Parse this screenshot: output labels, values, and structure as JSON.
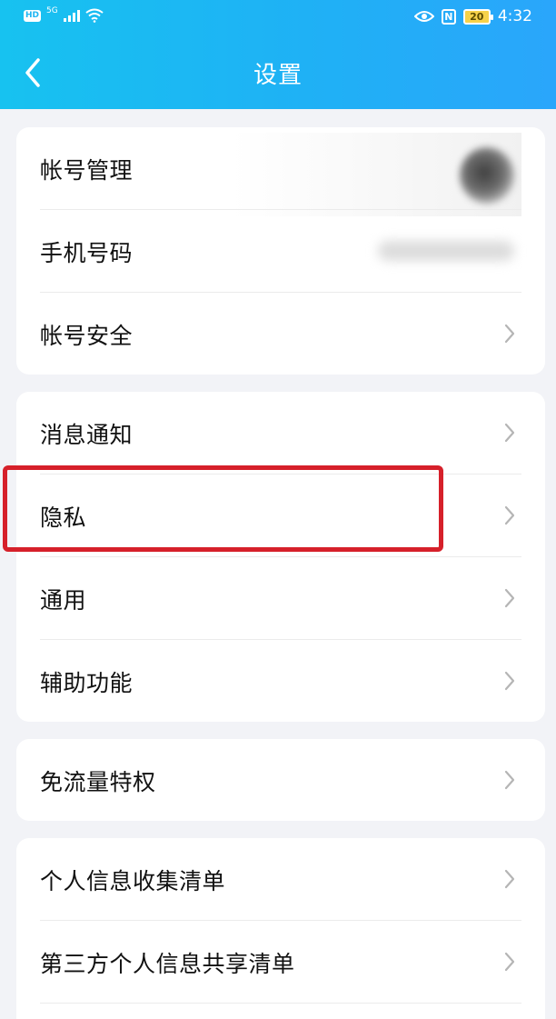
{
  "status_bar": {
    "hd": "HD",
    "network": "5G",
    "time": "4:32",
    "nfc": "N",
    "battery": "20"
  },
  "header": {
    "title": "设置",
    "back_icon": "chevron-left-icon"
  },
  "groups": [
    {
      "items": [
        {
          "label": "帐号管理",
          "trailing": "blurred-avatar"
        },
        {
          "label": "手机号码",
          "trailing": "blurred-phone-number"
        },
        {
          "label": "帐号安全",
          "trailing": "chevron-right-icon"
        }
      ]
    },
    {
      "items": [
        {
          "label": "消息通知",
          "trailing": "chevron-right-icon"
        },
        {
          "label": "隐私",
          "trailing": "chevron-right-icon",
          "highlighted": true
        },
        {
          "label": "通用",
          "trailing": "chevron-right-icon"
        },
        {
          "label": "辅助功能",
          "trailing": "chevron-right-icon"
        }
      ]
    },
    {
      "items": [
        {
          "label": "免流量特权",
          "trailing": "chevron-right-icon"
        }
      ]
    },
    {
      "items": [
        {
          "label": "个人信息收集清单",
          "trailing": "chevron-right-icon"
        },
        {
          "label": "第三方个人信息共享清单",
          "trailing": "chevron-right-icon"
        }
      ]
    }
  ],
  "colors": {
    "header_gradient_start": "#17c2f0",
    "header_gradient_end": "#2aa6fb",
    "page_bg": "#f2f3f7",
    "highlight_border": "#d6202a"
  }
}
